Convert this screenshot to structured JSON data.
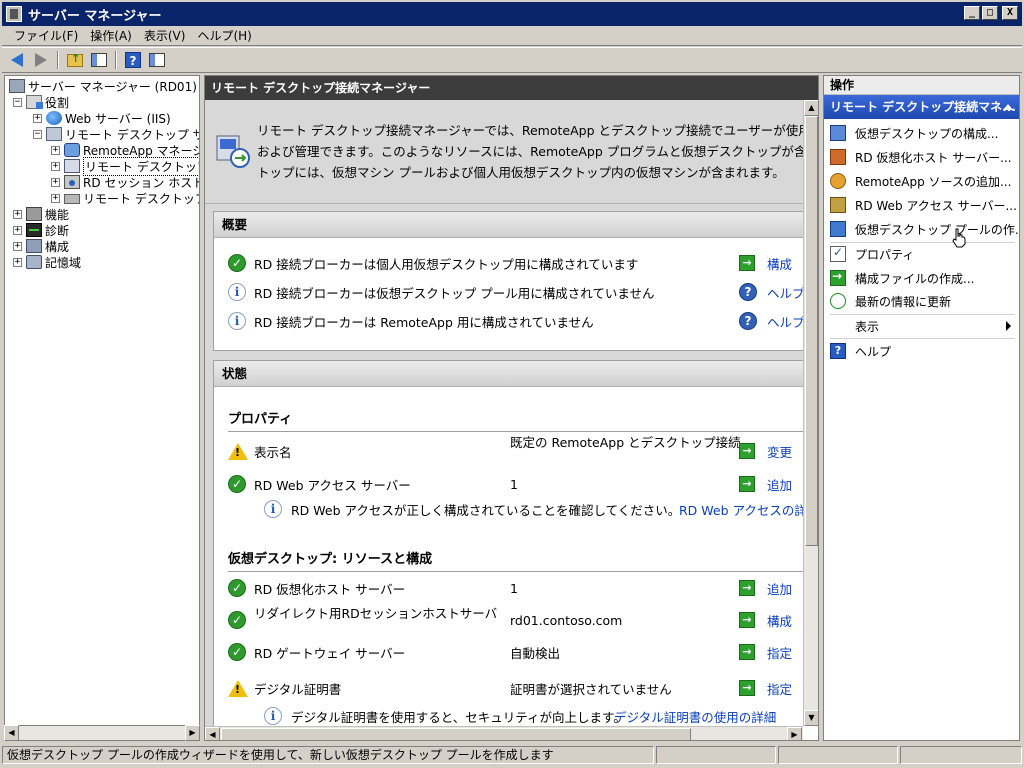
{
  "window": {
    "title": "サーバー マネージャー",
    "minimize": "_",
    "maximize": "□",
    "close": "X"
  },
  "menu": [
    "ファイル(F)",
    "操作(A)",
    "表示(V)",
    "ヘルプ(H)"
  ],
  "tree": {
    "root": "サーバー マネージャー (RD01)",
    "roles": "役割",
    "web_server": "Web サーバー (IIS)",
    "rds": "リモート デスクトップ サービス",
    "remoteapp": "RemoteApp マネージャー",
    "rdcm": "リモート デスクトップ接続マネージャー",
    "session_host": "RD セッション ホストの構成",
    "gateway": "リモート デスクトップ サービス",
    "features": "機能",
    "diagnostics": "診断",
    "configuration": "構成",
    "storage": "記憶域"
  },
  "center": {
    "header": "リモート デスクトップ接続マネージャー",
    "intro": [
      "リモート デスクトップ接続マネージャーでは、RemoteApp とデスクトップ接続でユーザーが使用可",
      "および管理できます。このようなリソースには、RemoteApp プログラムと仮想デスクトップが含まれ",
      "トップには、仮想マシン プールおよび個人用仮想デスクトップ内の仮想マシンが含まれます。"
    ],
    "overview": {
      "title": "概要",
      "rows": [
        {
          "text": "RD 接続ブローカーは個人用仮想デスクトップ用に構成されています",
          "action": "構成"
        },
        {
          "text": "RD 接続ブローカーは仮想デスクトップ プール用に構成されていません",
          "action": "ヘルプ"
        },
        {
          "text": "RD 接続ブローカーは RemoteApp 用に構成されていません",
          "action": "ヘルプ"
        }
      ]
    },
    "status": {
      "title": "状態",
      "properties_title": "プロパティ",
      "display_name_label": "表示名",
      "display_name_value": "既定の RemoteApp とデスクトップ接続",
      "display_name_action": "変更",
      "rdweb_label": "RD Web アクセス サーバー",
      "rdweb_value": "1",
      "rdweb_action": "追加",
      "rdweb_note": "RD Web アクセスが正しく構成されていることを確認してください。",
      "rdweb_note_link": "RD Web アクセスの詳",
      "vd_title": "仮想デスクトップ: リソースと構成",
      "vd_rows": [
        {
          "label": "RD 仮想化ホスト サーバー",
          "value": "1",
          "action": "追加",
          "status": "ok"
        },
        {
          "label": "リダイレクト用RDセッションホストサーバ",
          "value": "rd01.contoso.com",
          "action": "構成",
          "status": "ok"
        },
        {
          "label": "RD ゲートウェイ サーバー",
          "value": "自動検出",
          "action": "指定",
          "status": "ok"
        },
        {
          "label": "デジタル証明書",
          "value": "証明書が選択されていません",
          "action": "指定",
          "status": "warn"
        }
      ],
      "cert_note": "デジタル証明書を使用すると、セキュリティが向上します。",
      "cert_note_link": "デジタル証明書の使用の詳細"
    }
  },
  "actions": {
    "title": "操作",
    "section": "リモート デスクトップ接続マネ...",
    "items": [
      "仮想デスクトップの構成...",
      "RD 仮想化ホスト サーバー...",
      "RemoteApp ソースの追加...",
      "RD Web アクセス サーバー...",
      "仮想デスクトップ プールの作...",
      "プロパティ",
      "構成ファイルの作成...",
      "最新の情報に更新",
      "表示",
      "ヘルプ"
    ]
  },
  "statusbar": {
    "text": "仮想デスクトップ プールの作成ウィザードを使用して、新しい仮想デスクトップ プールを作成します"
  }
}
